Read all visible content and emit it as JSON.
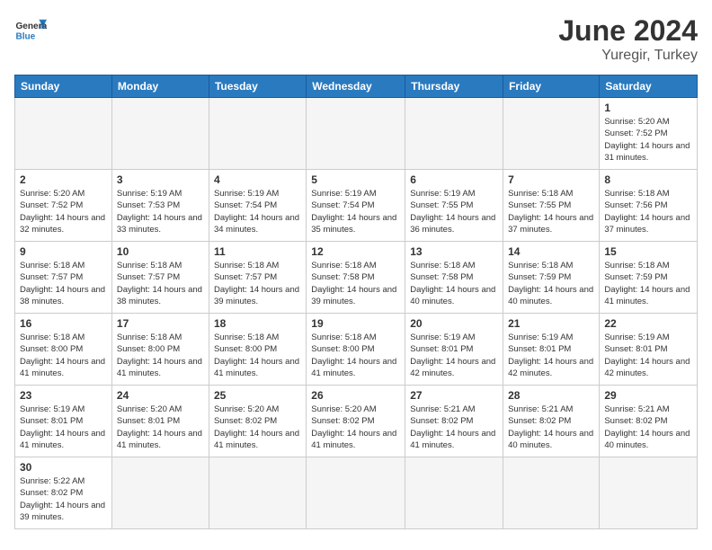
{
  "header": {
    "logo_general": "General",
    "logo_blue": "Blue",
    "month_title": "June 2024",
    "location": "Yuregir, Turkey"
  },
  "days_of_week": [
    "Sunday",
    "Monday",
    "Tuesday",
    "Wednesday",
    "Thursday",
    "Friday",
    "Saturday"
  ],
  "weeks": [
    [
      {
        "day": "",
        "info": ""
      },
      {
        "day": "",
        "info": ""
      },
      {
        "day": "",
        "info": ""
      },
      {
        "day": "",
        "info": ""
      },
      {
        "day": "",
        "info": ""
      },
      {
        "day": "",
        "info": ""
      },
      {
        "day": "1",
        "info": "Sunrise: 5:20 AM\nSunset: 7:52 PM\nDaylight: 14 hours and 31 minutes."
      }
    ],
    [
      {
        "day": "2",
        "info": "Sunrise: 5:20 AM\nSunset: 7:52 PM\nDaylight: 14 hours and 32 minutes."
      },
      {
        "day": "3",
        "info": "Sunrise: 5:19 AM\nSunset: 7:53 PM\nDaylight: 14 hours and 33 minutes."
      },
      {
        "day": "4",
        "info": "Sunrise: 5:19 AM\nSunset: 7:54 PM\nDaylight: 14 hours and 34 minutes."
      },
      {
        "day": "5",
        "info": "Sunrise: 5:19 AM\nSunset: 7:54 PM\nDaylight: 14 hours and 35 minutes."
      },
      {
        "day": "6",
        "info": "Sunrise: 5:19 AM\nSunset: 7:55 PM\nDaylight: 14 hours and 36 minutes."
      },
      {
        "day": "7",
        "info": "Sunrise: 5:18 AM\nSunset: 7:55 PM\nDaylight: 14 hours and 37 minutes."
      },
      {
        "day": "8",
        "info": "Sunrise: 5:18 AM\nSunset: 7:56 PM\nDaylight: 14 hours and 37 minutes."
      }
    ],
    [
      {
        "day": "9",
        "info": "Sunrise: 5:18 AM\nSunset: 7:57 PM\nDaylight: 14 hours and 38 minutes."
      },
      {
        "day": "10",
        "info": "Sunrise: 5:18 AM\nSunset: 7:57 PM\nDaylight: 14 hours and 38 minutes."
      },
      {
        "day": "11",
        "info": "Sunrise: 5:18 AM\nSunset: 7:57 PM\nDaylight: 14 hours and 39 minutes."
      },
      {
        "day": "12",
        "info": "Sunrise: 5:18 AM\nSunset: 7:58 PM\nDaylight: 14 hours and 39 minutes."
      },
      {
        "day": "13",
        "info": "Sunrise: 5:18 AM\nSunset: 7:58 PM\nDaylight: 14 hours and 40 minutes."
      },
      {
        "day": "14",
        "info": "Sunrise: 5:18 AM\nSunset: 7:59 PM\nDaylight: 14 hours and 40 minutes."
      },
      {
        "day": "15",
        "info": "Sunrise: 5:18 AM\nSunset: 7:59 PM\nDaylight: 14 hours and 41 minutes."
      }
    ],
    [
      {
        "day": "16",
        "info": "Sunrise: 5:18 AM\nSunset: 8:00 PM\nDaylight: 14 hours and 41 minutes."
      },
      {
        "day": "17",
        "info": "Sunrise: 5:18 AM\nSunset: 8:00 PM\nDaylight: 14 hours and 41 minutes."
      },
      {
        "day": "18",
        "info": "Sunrise: 5:18 AM\nSunset: 8:00 PM\nDaylight: 14 hours and 41 minutes."
      },
      {
        "day": "19",
        "info": "Sunrise: 5:18 AM\nSunset: 8:00 PM\nDaylight: 14 hours and 41 minutes."
      },
      {
        "day": "20",
        "info": "Sunrise: 5:19 AM\nSunset: 8:01 PM\nDaylight: 14 hours and 42 minutes."
      },
      {
        "day": "21",
        "info": "Sunrise: 5:19 AM\nSunset: 8:01 PM\nDaylight: 14 hours and 42 minutes."
      },
      {
        "day": "22",
        "info": "Sunrise: 5:19 AM\nSunset: 8:01 PM\nDaylight: 14 hours and 42 minutes."
      }
    ],
    [
      {
        "day": "23",
        "info": "Sunrise: 5:19 AM\nSunset: 8:01 PM\nDaylight: 14 hours and 41 minutes."
      },
      {
        "day": "24",
        "info": "Sunrise: 5:20 AM\nSunset: 8:01 PM\nDaylight: 14 hours and 41 minutes."
      },
      {
        "day": "25",
        "info": "Sunrise: 5:20 AM\nSunset: 8:02 PM\nDaylight: 14 hours and 41 minutes."
      },
      {
        "day": "26",
        "info": "Sunrise: 5:20 AM\nSunset: 8:02 PM\nDaylight: 14 hours and 41 minutes."
      },
      {
        "day": "27",
        "info": "Sunrise: 5:21 AM\nSunset: 8:02 PM\nDaylight: 14 hours and 41 minutes."
      },
      {
        "day": "28",
        "info": "Sunrise: 5:21 AM\nSunset: 8:02 PM\nDaylight: 14 hours and 40 minutes."
      },
      {
        "day": "29",
        "info": "Sunrise: 5:21 AM\nSunset: 8:02 PM\nDaylight: 14 hours and 40 minutes."
      }
    ],
    [
      {
        "day": "30",
        "info": "Sunrise: 5:22 AM\nSunset: 8:02 PM\nDaylight: 14 hours and 39 minutes."
      },
      {
        "day": "",
        "info": ""
      },
      {
        "day": "",
        "info": ""
      },
      {
        "day": "",
        "info": ""
      },
      {
        "day": "",
        "info": ""
      },
      {
        "day": "",
        "info": ""
      },
      {
        "day": "",
        "info": ""
      }
    ]
  ]
}
